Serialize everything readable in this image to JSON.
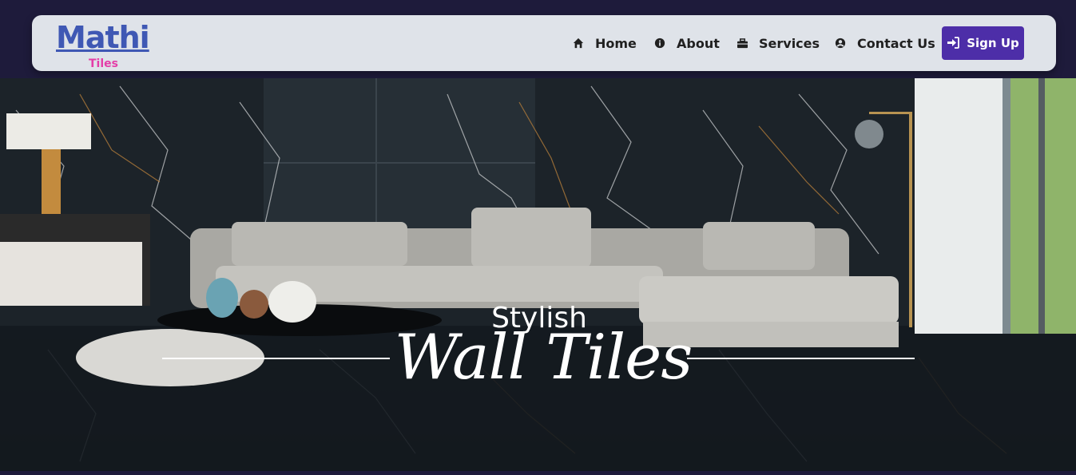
{
  "brand": {
    "name": "Mathi",
    "tagline": "Tiles"
  },
  "nav": {
    "items": [
      {
        "label": "Home",
        "icon": "home-icon"
      },
      {
        "label": "About",
        "icon": "info-icon"
      },
      {
        "label": "Services",
        "icon": "briefcase-icon"
      },
      {
        "label": "Contact Us",
        "icon": "user-circle-icon"
      }
    ],
    "signup_label": "Sign Up",
    "signup_icon": "sign-in-icon"
  },
  "hero": {
    "line1": "Stylish",
    "line2": "Wall Tiles",
    "image_desc": "living-room-with-sofa-and-black-marble-tiles"
  },
  "colors": {
    "brand_blue": "#3f58b4",
    "brand_pink": "#e43ea8",
    "signup_bg": "#4d2ea8",
    "navbar_bg": "#dfe3e9",
    "page_bg": "#1e1b3b"
  }
}
